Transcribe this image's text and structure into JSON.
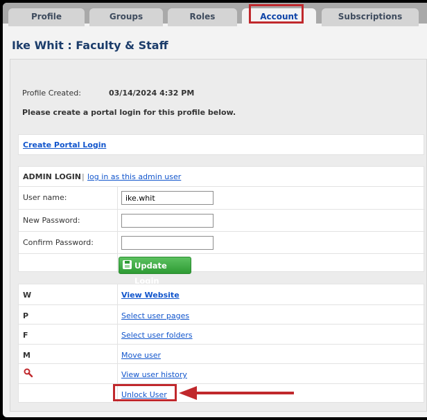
{
  "tabs": [
    {
      "label": "Profile"
    },
    {
      "label": "Groups"
    },
    {
      "label": "Roles"
    },
    {
      "label": "Account",
      "active": true
    },
    {
      "label": "Subscriptions"
    }
  ],
  "page_title": "Ike Whit : Faculty & Staff",
  "profile_created_label": "Profile Created:",
  "profile_created_value": "03/14/2024 4:32 PM",
  "instruction": "Please create a portal login for this profile below.",
  "create_portal_login": "Create Portal Login",
  "admin_login": {
    "heading": "ADMIN LOGIN",
    "separator": "|",
    "login_as_link": "log in as this admin user",
    "username_label": "User name:",
    "username_value": "ike.whit",
    "new_password_label": "New Password:",
    "new_password_value": "",
    "confirm_password_label": "Confirm Password:",
    "confirm_password_value": "",
    "update_button": "Update Login"
  },
  "actions": [
    {
      "code": "W",
      "label": "View Website"
    },
    {
      "code": "P",
      "label": "Select user pages"
    },
    {
      "code": "F",
      "label": "Select user folders"
    },
    {
      "code": "M",
      "label": "Move user"
    },
    {
      "code": "",
      "icon": "magnifier-icon",
      "label": "View user history"
    },
    {
      "code": "",
      "label": "Unlock User"
    }
  ],
  "colors": {
    "tab_bar": "#a9a9a9",
    "active_tab_text": "#0f45a8",
    "title": "#1c3d6b",
    "link": "#1155cc",
    "update_button": "#2e9b34",
    "annotation_red": "#c0282c"
  }
}
